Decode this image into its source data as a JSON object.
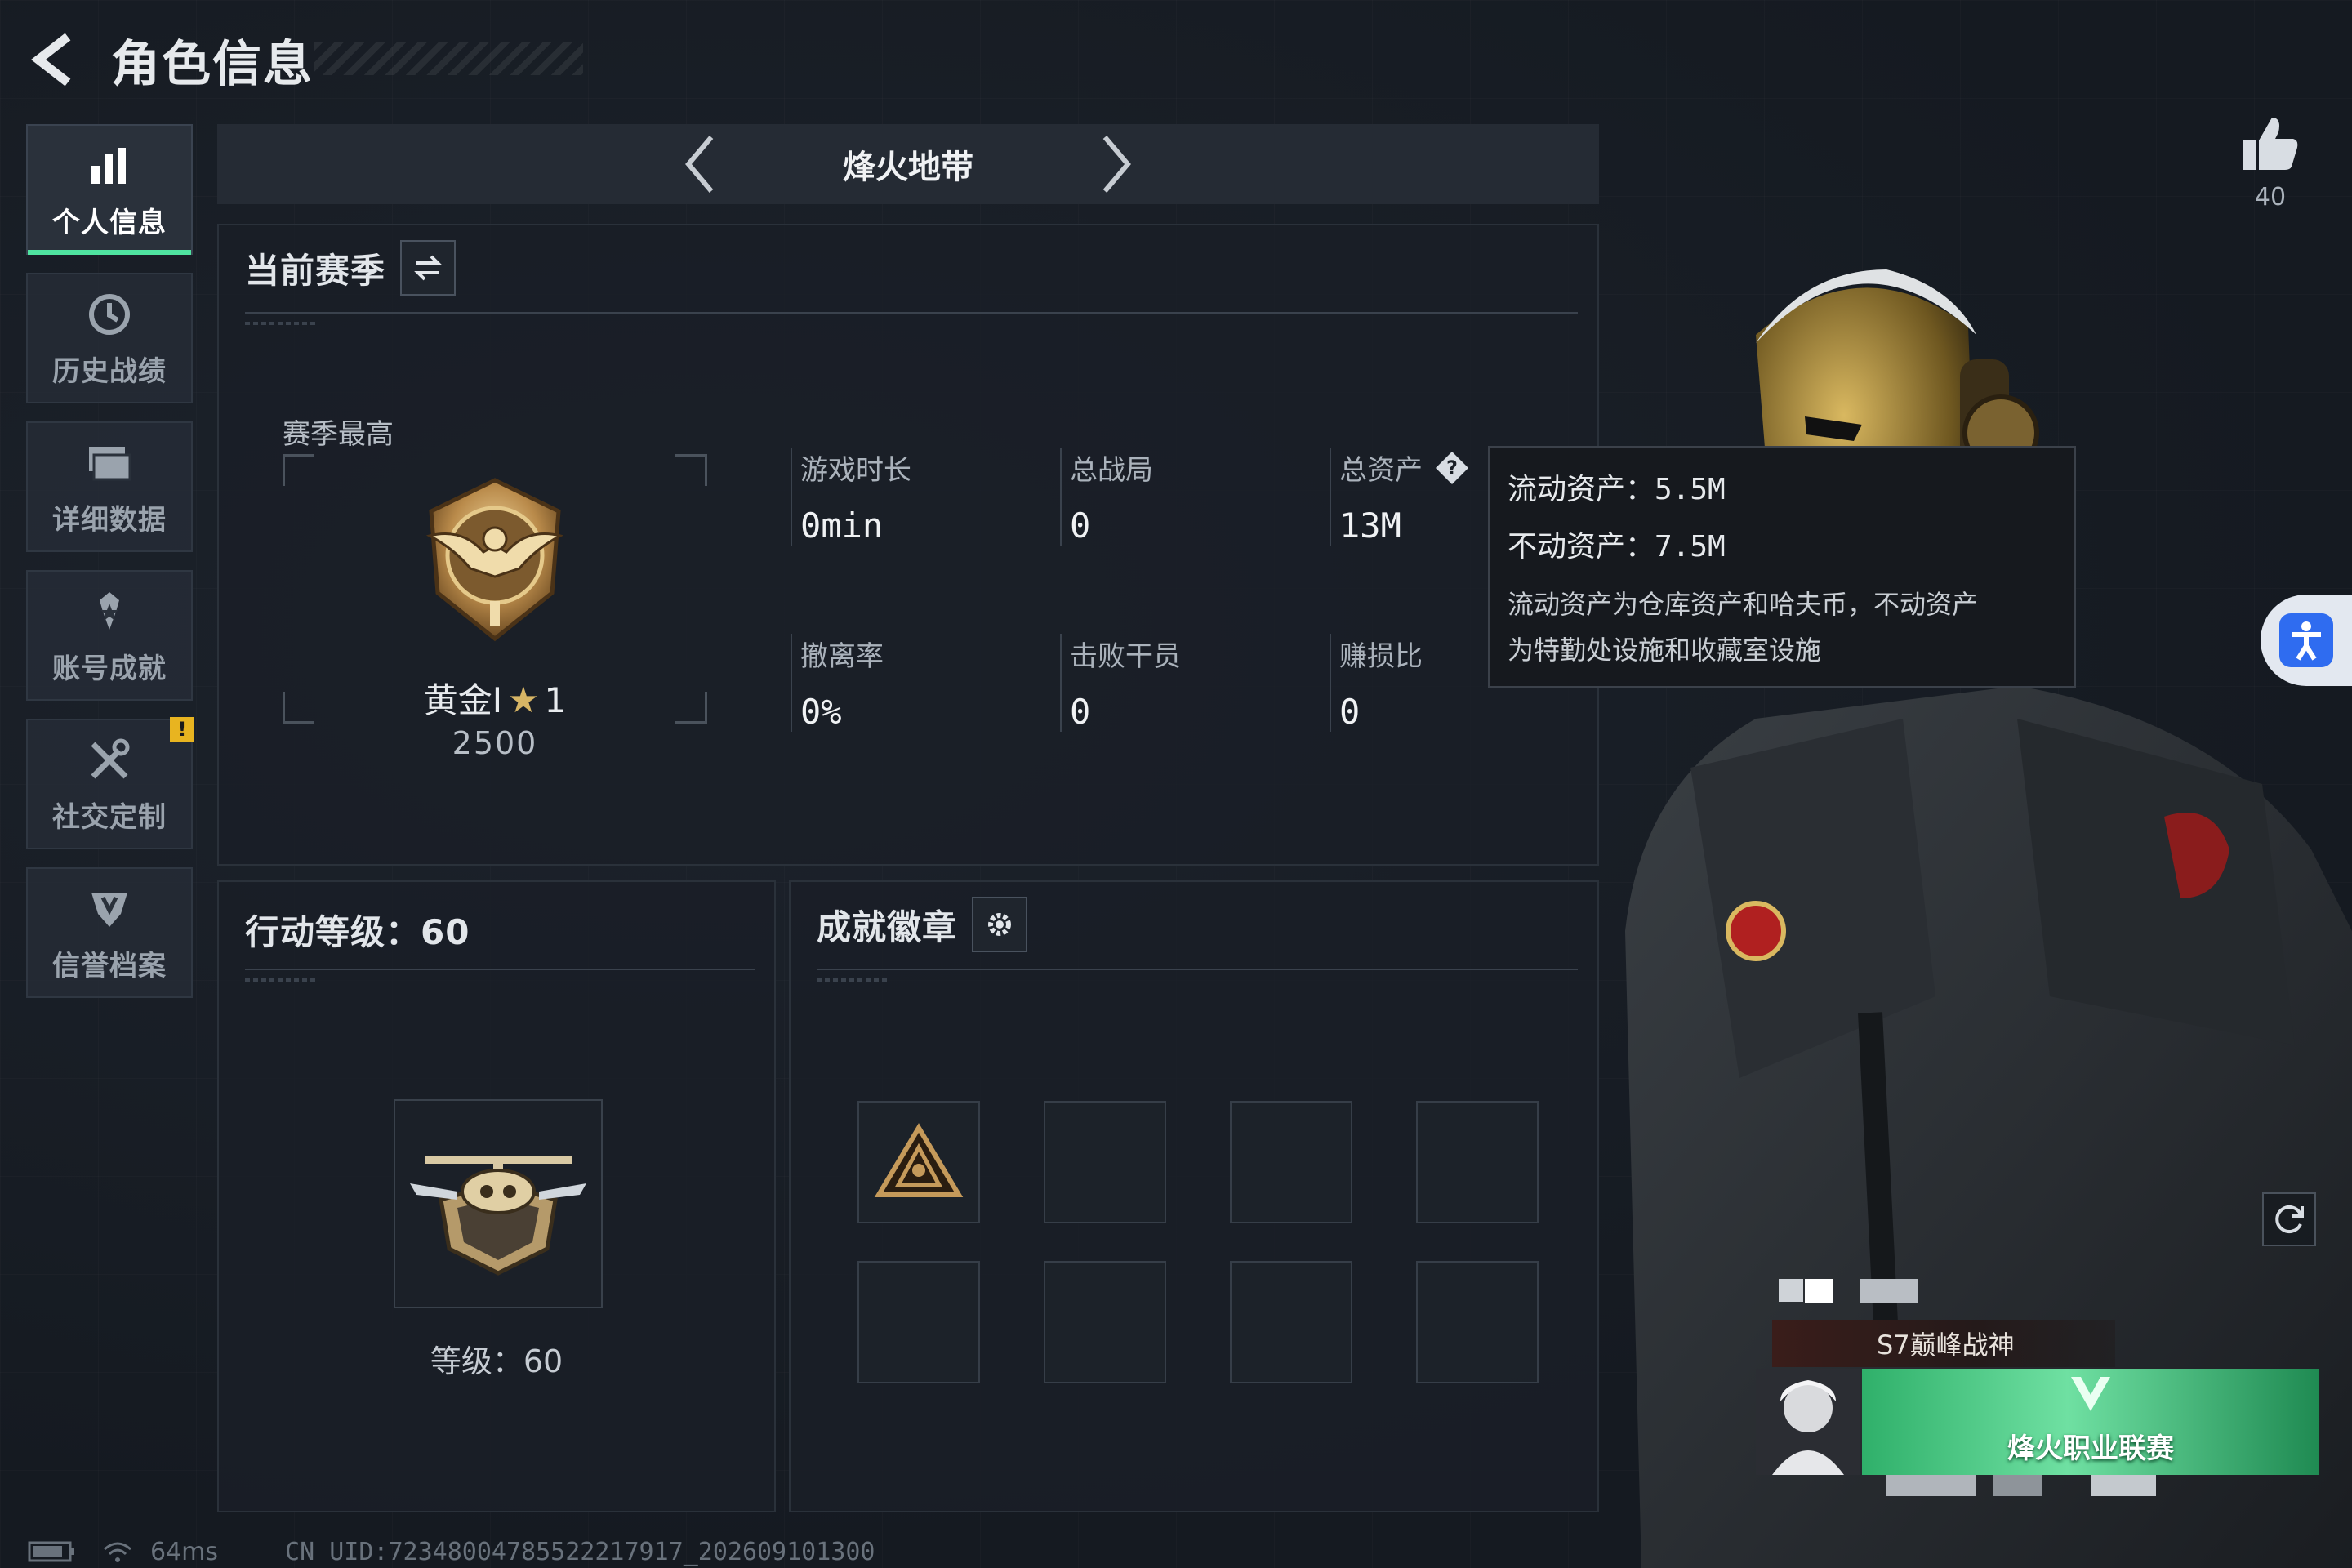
{
  "header": {
    "title": "角色信息"
  },
  "sidebar": {
    "items": [
      {
        "label": "个人信息",
        "icon": "bar-chart-icon",
        "active": true
      },
      {
        "label": "历史战绩",
        "icon": "history-clock-icon"
      },
      {
        "label": "详细数据",
        "icon": "folder-icon"
      },
      {
        "label": "账号成就",
        "icon": "achievement-star-icon"
      },
      {
        "label": "社交定制",
        "icon": "tools-icon",
        "badge": "!"
      },
      {
        "label": "信誉档案",
        "icon": "shield-emblem-icon"
      }
    ]
  },
  "mode": {
    "title": "烽火地带"
  },
  "season": {
    "title": "当前赛季",
    "peak_label": "赛季最高",
    "rank_name": "黄金I",
    "rank_stars": "1",
    "rank_score": "2500",
    "stats": [
      {
        "label": "游戏时长",
        "value": "0min"
      },
      {
        "label": "总战局",
        "value": "0"
      },
      {
        "label": "总资产",
        "value": "13M"
      },
      {
        "label": "撤离率",
        "value": "0%"
      },
      {
        "label": "击败干员",
        "value": "0"
      },
      {
        "label": "赚损比",
        "value": "0"
      }
    ]
  },
  "tooltip": {
    "liquid": "流动资产：5.5M",
    "fixed": "不动资产：7.5M",
    "desc_line1": "流动资产为仓库资产和哈夫币，不动资产",
    "desc_line2": "为特勤处设施和收藏室设施"
  },
  "level": {
    "title": "行动等级：60",
    "text": "等级：60"
  },
  "badges": {
    "title": "成就徽章"
  },
  "profile": {
    "likes": "40",
    "player_title": "S7巅峰战神",
    "banner_text": "烽火职业联赛"
  },
  "status": {
    "ping": "64ms",
    "uid": "CN UID:72348004785522217917_202609101300"
  },
  "colors": {
    "accent": "#4fe3a0",
    "warning": "#e8b420",
    "gold": "#d7b565",
    "access_blue": "#2f6cf0"
  }
}
